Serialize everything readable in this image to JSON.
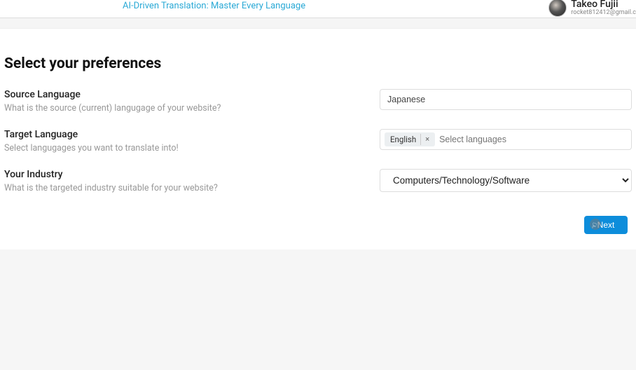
{
  "header": {
    "tagline": "AI-Driven Translation: Master Every Language",
    "user": {
      "name": "Takeo Fujii",
      "email": "rocket812412@gmail.c"
    }
  },
  "page": {
    "title": "Select your preferences"
  },
  "fields": {
    "source": {
      "label": "Source Language",
      "desc": "What is the source (current) langugage of your website?",
      "value": "Japanese"
    },
    "target": {
      "label": "Target Language",
      "desc": "Select langugages you want to translate into!",
      "chip": "English",
      "chip_x": "×",
      "placeholder": "Select languages"
    },
    "industry": {
      "label": "Your Industry",
      "desc": "What is the targeted industry suitable for your website?",
      "value": "Computers/Technology/Software"
    }
  },
  "buttons": {
    "next": "Next"
  }
}
